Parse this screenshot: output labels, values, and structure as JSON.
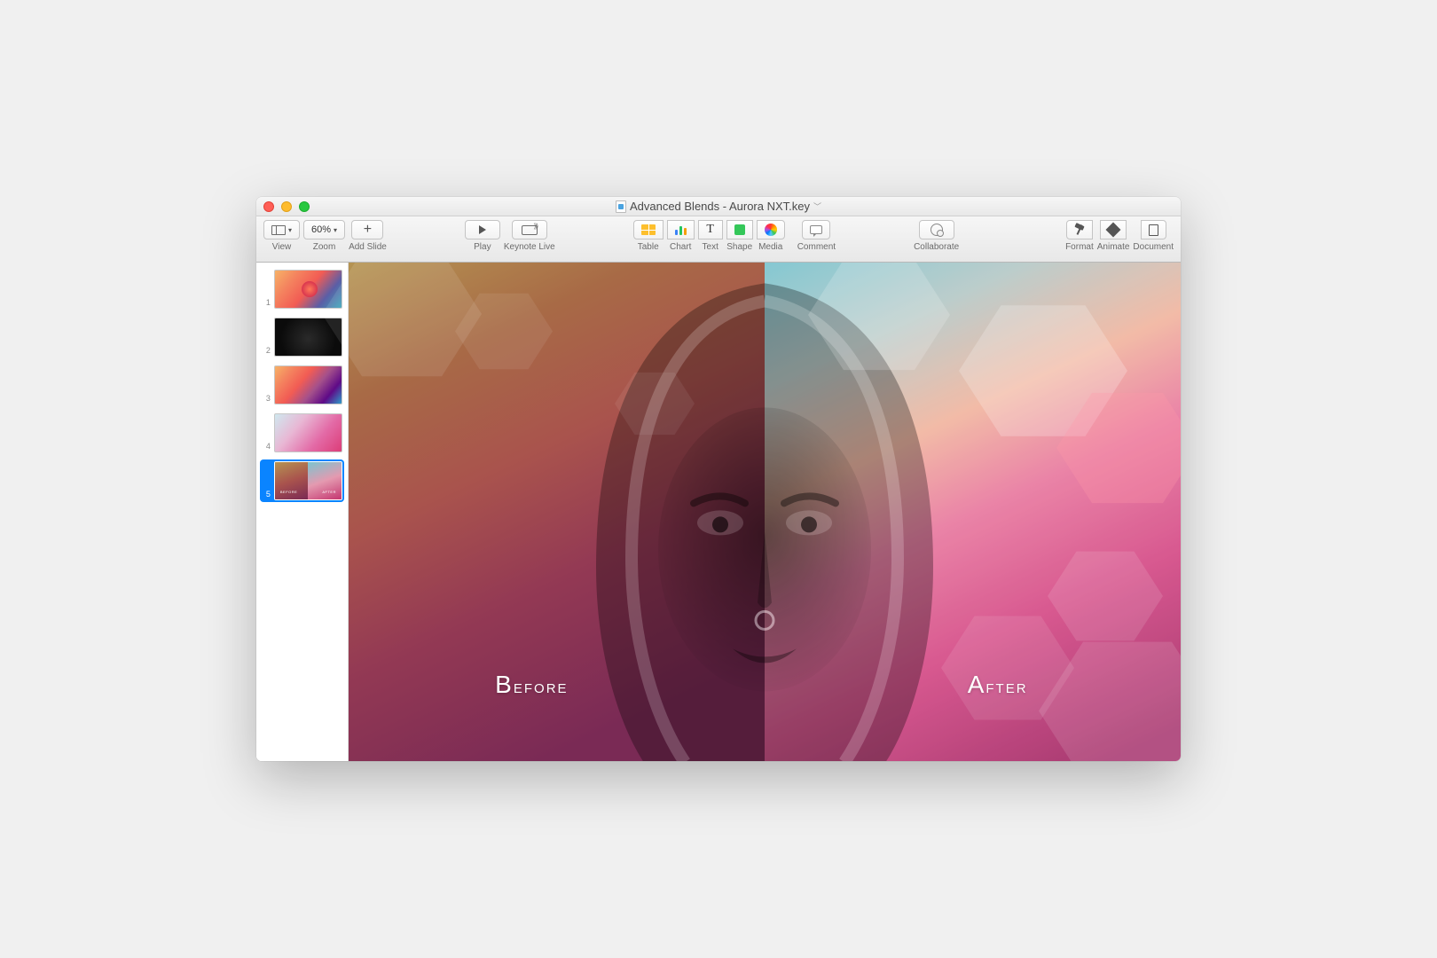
{
  "window": {
    "title": "Advanced Blends - Aurora NXT.key"
  },
  "toolbar": {
    "view_label": "View",
    "zoom_value": "60%",
    "zoom_label": "Zoom",
    "add_slide_label": "Add Slide",
    "play_label": "Play",
    "keynote_live_label": "Keynote Live",
    "table_label": "Table",
    "chart_label": "Chart",
    "text_label": "Text",
    "text_glyph": "T",
    "shape_label": "Shape",
    "media_label": "Media",
    "comment_label": "Comment",
    "collaborate_label": "Collaborate",
    "format_label": "Format",
    "animate_label": "Animate",
    "document_label": "Document"
  },
  "navigator": {
    "slides": [
      {
        "num": "1"
      },
      {
        "num": "2"
      },
      {
        "num": "3"
      },
      {
        "num": "4"
      },
      {
        "num": "5"
      }
    ],
    "selected_index": 4
  },
  "slide": {
    "left_label": "Before",
    "right_label": "After"
  }
}
